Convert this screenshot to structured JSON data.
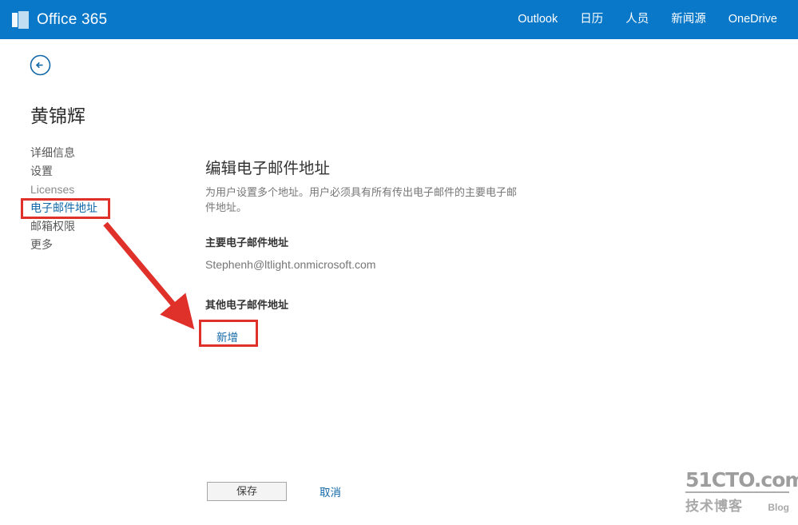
{
  "suite_bar": {
    "brand": "Office 365",
    "brand_icon": "office-waffle-icon",
    "nav": [
      {
        "label": "Outlook"
      },
      {
        "label": "日历"
      },
      {
        "label": "人员"
      },
      {
        "label": "新闻源"
      },
      {
        "label": "OneDrive"
      }
    ],
    "background_color": "#0a78c9",
    "text_color": "#ffffff"
  },
  "back_button": {
    "icon": "back-arrow-circle-icon",
    "color": "#1168a8"
  },
  "page_title": "黄锦辉",
  "left_nav": {
    "items": [
      {
        "label": "详细信息",
        "state": "normal"
      },
      {
        "label": "设置",
        "state": "normal"
      },
      {
        "label": "Licenses",
        "state": "muted"
      },
      {
        "label": "电子邮件地址",
        "state": "selected"
      },
      {
        "label": "邮箱权限",
        "state": "normal"
      },
      {
        "label": "更多",
        "state": "normal"
      }
    ],
    "selected_color": "#1168a8"
  },
  "content": {
    "heading": "编辑电子邮件地址",
    "description": "为用户设置多个地址。用户必须具有所有传出电子邮件的主要电子邮件地址。",
    "primary_email_label": "主要电子邮件地址",
    "primary_email_value": "Stephenh@ltlight.onmicrosoft.com",
    "other_email_label": "其他电子邮件地址",
    "add_link_label": "新增"
  },
  "footer": {
    "save_label": "保存",
    "cancel_label": "取消"
  },
  "annotations": {
    "color": "#e0302a",
    "arrow_icon": "red-pointer-arrow-icon",
    "box_nav_target": "电子邮件地址",
    "box_add_target": "新增"
  },
  "watermark": {
    "top": "51CTO.com",
    "bottom_cn": "技术博客",
    "bottom_en": "Blog"
  }
}
